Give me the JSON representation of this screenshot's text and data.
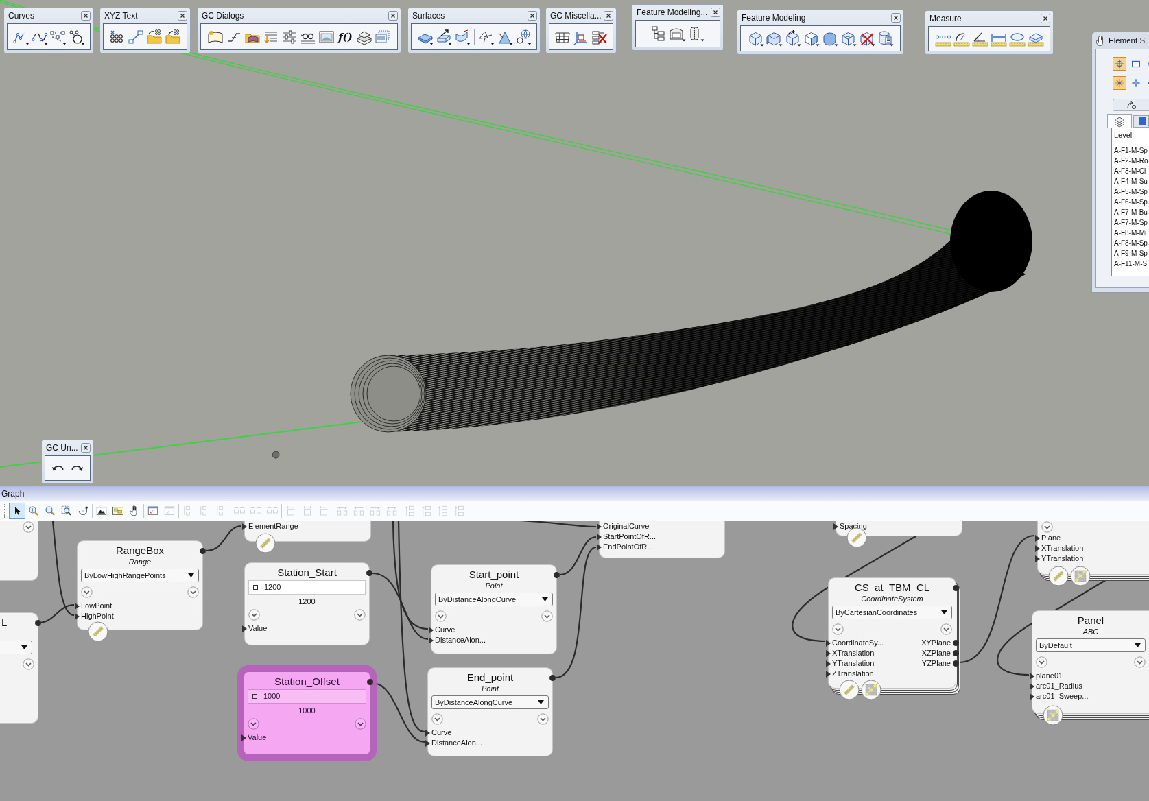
{
  "viewport": {
    "toolbars": [
      {
        "title": "Curves"
      },
      {
        "title": "XYZ Text"
      },
      {
        "title": "GC Dialogs",
        "function_button": "f()"
      },
      {
        "title": "Surfaces"
      },
      {
        "title": "GC Miscella..."
      },
      {
        "title": "Feature Modeling..."
      },
      {
        "title": "Feature Modeling"
      },
      {
        "title": "Measure"
      },
      {
        "title": "GC Un..."
      }
    ],
    "element_panel": {
      "title": "Element S",
      "tools": [
        {
          "selected": true
        },
        {
          "selected": false
        },
        {
          "selected": false
        },
        {
          "selected": true
        },
        {
          "selected": false
        },
        {
          "selected": false
        }
      ],
      "tabs": [
        {
          "selected": true
        },
        {
          "selected": false
        }
      ],
      "list_header": "Level",
      "levels": [
        {
          "name": "A-F1-M-Sp",
          "selected": false
        },
        {
          "name": "A-F2-M-Ro",
          "selected": false
        },
        {
          "name": "A-F3-M-Ci",
          "selected": false
        },
        {
          "name": "A-F4-M-Su",
          "selected": false
        },
        {
          "name": "A-F5-M-Sp",
          "selected": false
        },
        {
          "name": "A-F6-M-Sp",
          "selected": false
        },
        {
          "name": "A-F7-M-Bu",
          "selected": false
        },
        {
          "name": "A-F7-M-Sp",
          "selected": false
        },
        {
          "name": "A-F8-M-Mi",
          "selected": false
        },
        {
          "name": "A-F8-M-Sp",
          "selected": false
        },
        {
          "name": "A-F9-M-Sp",
          "selected": false
        },
        {
          "name": "A-F11-M-S",
          "selected": false
        }
      ]
    }
  },
  "graph": {
    "title": "Graph",
    "tools": [
      {
        "selected": true,
        "disabled": false
      },
      {
        "selected": false,
        "disabled": false
      },
      {
        "selected": false,
        "disabled": false
      },
      {
        "selected": false,
        "disabled": false
      },
      {
        "selected": false,
        "disabled": false
      },
      {
        "selected": false,
        "disabled": false
      },
      {
        "selected": false,
        "disabled": false
      },
      {
        "selected": false,
        "disabled": false
      },
      {
        "selected": false,
        "disabled": false
      },
      {
        "selected": false,
        "disabled": true
      },
      {
        "selected": false,
        "disabled": true
      },
      {
        "selected": false,
        "disabled": true
      },
      {
        "selected": false,
        "disabled": true
      },
      {
        "selected": false,
        "disabled": true
      },
      {
        "selected": false,
        "disabled": true
      },
      {
        "selected": false,
        "disabled": true
      },
      {
        "selected": false,
        "disabled": true
      },
      {
        "selected": false,
        "disabled": true
      },
      {
        "selected": false,
        "disabled": true
      },
      {
        "selected": false,
        "disabled": true
      },
      {
        "selected": false,
        "disabled": true
      },
      {
        "selected": false,
        "disabled": true
      },
      {
        "selected": false,
        "disabled": true
      },
      {
        "selected": false,
        "disabled": true
      },
      {
        "selected": false,
        "disabled": true
      },
      {
        "selected": false,
        "disabled": true
      },
      {
        "selected": false,
        "disabled": true
      }
    ],
    "nodes": [
      {
        "expand_left": false,
        "expand_right": true,
        "dropdown": false,
        "output": false,
        "stacked": false,
        "selected": false
      },
      {
        "inputs": [
          "ElementRange"
        ],
        "badges": [
          {
            "kind": "line"
          }
        ],
        "expand_left": false,
        "expand_right": false,
        "dropdown": false,
        "output": false,
        "stacked": false,
        "selected": false
      },
      {
        "inputs": [
          "OriginalCurve",
          "StartPointOfR...",
          "EndPointOfR..."
        ],
        "expand_left": false,
        "expand_right": false,
        "dropdown": false,
        "output": false,
        "stacked": false,
        "selected": false
      },
      {
        "inputs": [
          "Spacing"
        ],
        "badges": [
          {
            "kind": "line"
          }
        ],
        "expand_left": false,
        "expand_right": false,
        "dropdown": false,
        "output": false,
        "stacked": false,
        "selected": false
      },
      {
        "inputs": [
          "Plane",
          "XTranslation",
          "YTranslation"
        ],
        "badges": [
          {
            "kind": "line"
          },
          {
            "kind": "grid"
          }
        ],
        "expand_left": true,
        "expand_right": false,
        "dropdown": false,
        "output": false,
        "stacked": true,
        "selected": false
      },
      {
        "title": "RangeBox",
        "type": "Range",
        "method": "ByLowHighRangePoints",
        "inputs": [
          "LowPoint",
          "HighPoint"
        ],
        "badges": [
          {
            "kind": "line"
          }
        ],
        "expand_left": true,
        "expand_right": true,
        "dropdown": true,
        "output": true,
        "stacked": false,
        "selected": false
      },
      {
        "title": "Station_Start",
        "value": "1200",
        "result": "1200",
        "inputs": [
          "Value"
        ],
        "expand_left": true,
        "expand_right": true,
        "dropdown": false,
        "output": true,
        "stacked": false,
        "selected": false
      },
      {
        "title": "Start_point",
        "type": "Point",
        "method": "ByDistanceAlongCurve",
        "inputs": [
          "Curve",
          "DistanceAlon..."
        ],
        "expand_left": true,
        "expand_right": true,
        "dropdown": true,
        "output": true,
        "stacked": false,
        "selected": false
      },
      {
        "title": "CS_at_TBM_CL",
        "type": "CoordinateSystem",
        "method": "ByCartesianCoordinates",
        "inputs": [
          "CoordinateSy...",
          "XTranslation",
          "YTranslation",
          "ZTranslation"
        ],
        "outputs": [
          "XYPlane",
          "XZPlane",
          "YZPlane"
        ],
        "badges": [
          {
            "kind": "line"
          },
          {
            "kind": "grid"
          }
        ],
        "expand_left": true,
        "expand_right": true,
        "dropdown": true,
        "output": true,
        "stacked": true,
        "selected": false
      },
      {
        "title": "L",
        "expand_left": false,
        "expand_right": true,
        "dropdown": true,
        "output": true,
        "stacked": false,
        "selected": false
      },
      {
        "title": "Panel",
        "type": "ABC",
        "method": "ByDefault",
        "inputs": [
          "plane01",
          "arc01_Radius",
          "arc01_Sweep..."
        ],
        "badges": [
          {
            "kind": "grid"
          }
        ],
        "expand_left": true,
        "expand_right": true,
        "dropdown": true,
        "output": false,
        "stacked": true,
        "selected": false
      },
      {
        "title": "Station_Offset",
        "value": "1000",
        "result": "1000",
        "inputs": [
          "Value"
        ],
        "expand_left": true,
        "expand_right": true,
        "dropdown": false,
        "output": true,
        "stacked": false,
        "selected": true
      },
      {
        "title": "End_point",
        "type": "Point",
        "method": "ByDistanceAlongCurve",
        "inputs": [
          "Curve",
          "DistanceAlon..."
        ],
        "expand_left": true,
        "expand_right": true,
        "dropdown": true,
        "output": true,
        "stacked": false,
        "selected": false
      }
    ]
  }
}
